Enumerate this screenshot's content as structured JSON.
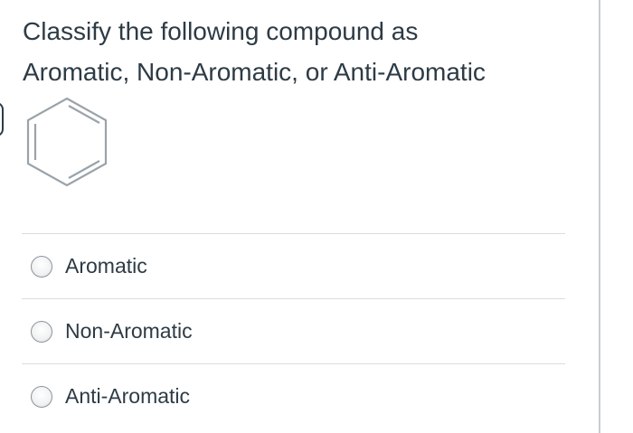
{
  "question": {
    "line1": "Classify the following compound as",
    "line2": "Aromatic, Non-Aromatic, or Anti-Aromatic"
  },
  "structure_icon": "benzene-ring-icon",
  "answers": [
    {
      "label": "Aromatic",
      "selected": false
    },
    {
      "label": "Non-Aromatic",
      "selected": false
    },
    {
      "label": "Anti-Aromatic",
      "selected": false
    }
  ],
  "colors": {
    "text": "#2d3b45",
    "divider": "#d9dde0",
    "radio_border": "#8b959c"
  }
}
